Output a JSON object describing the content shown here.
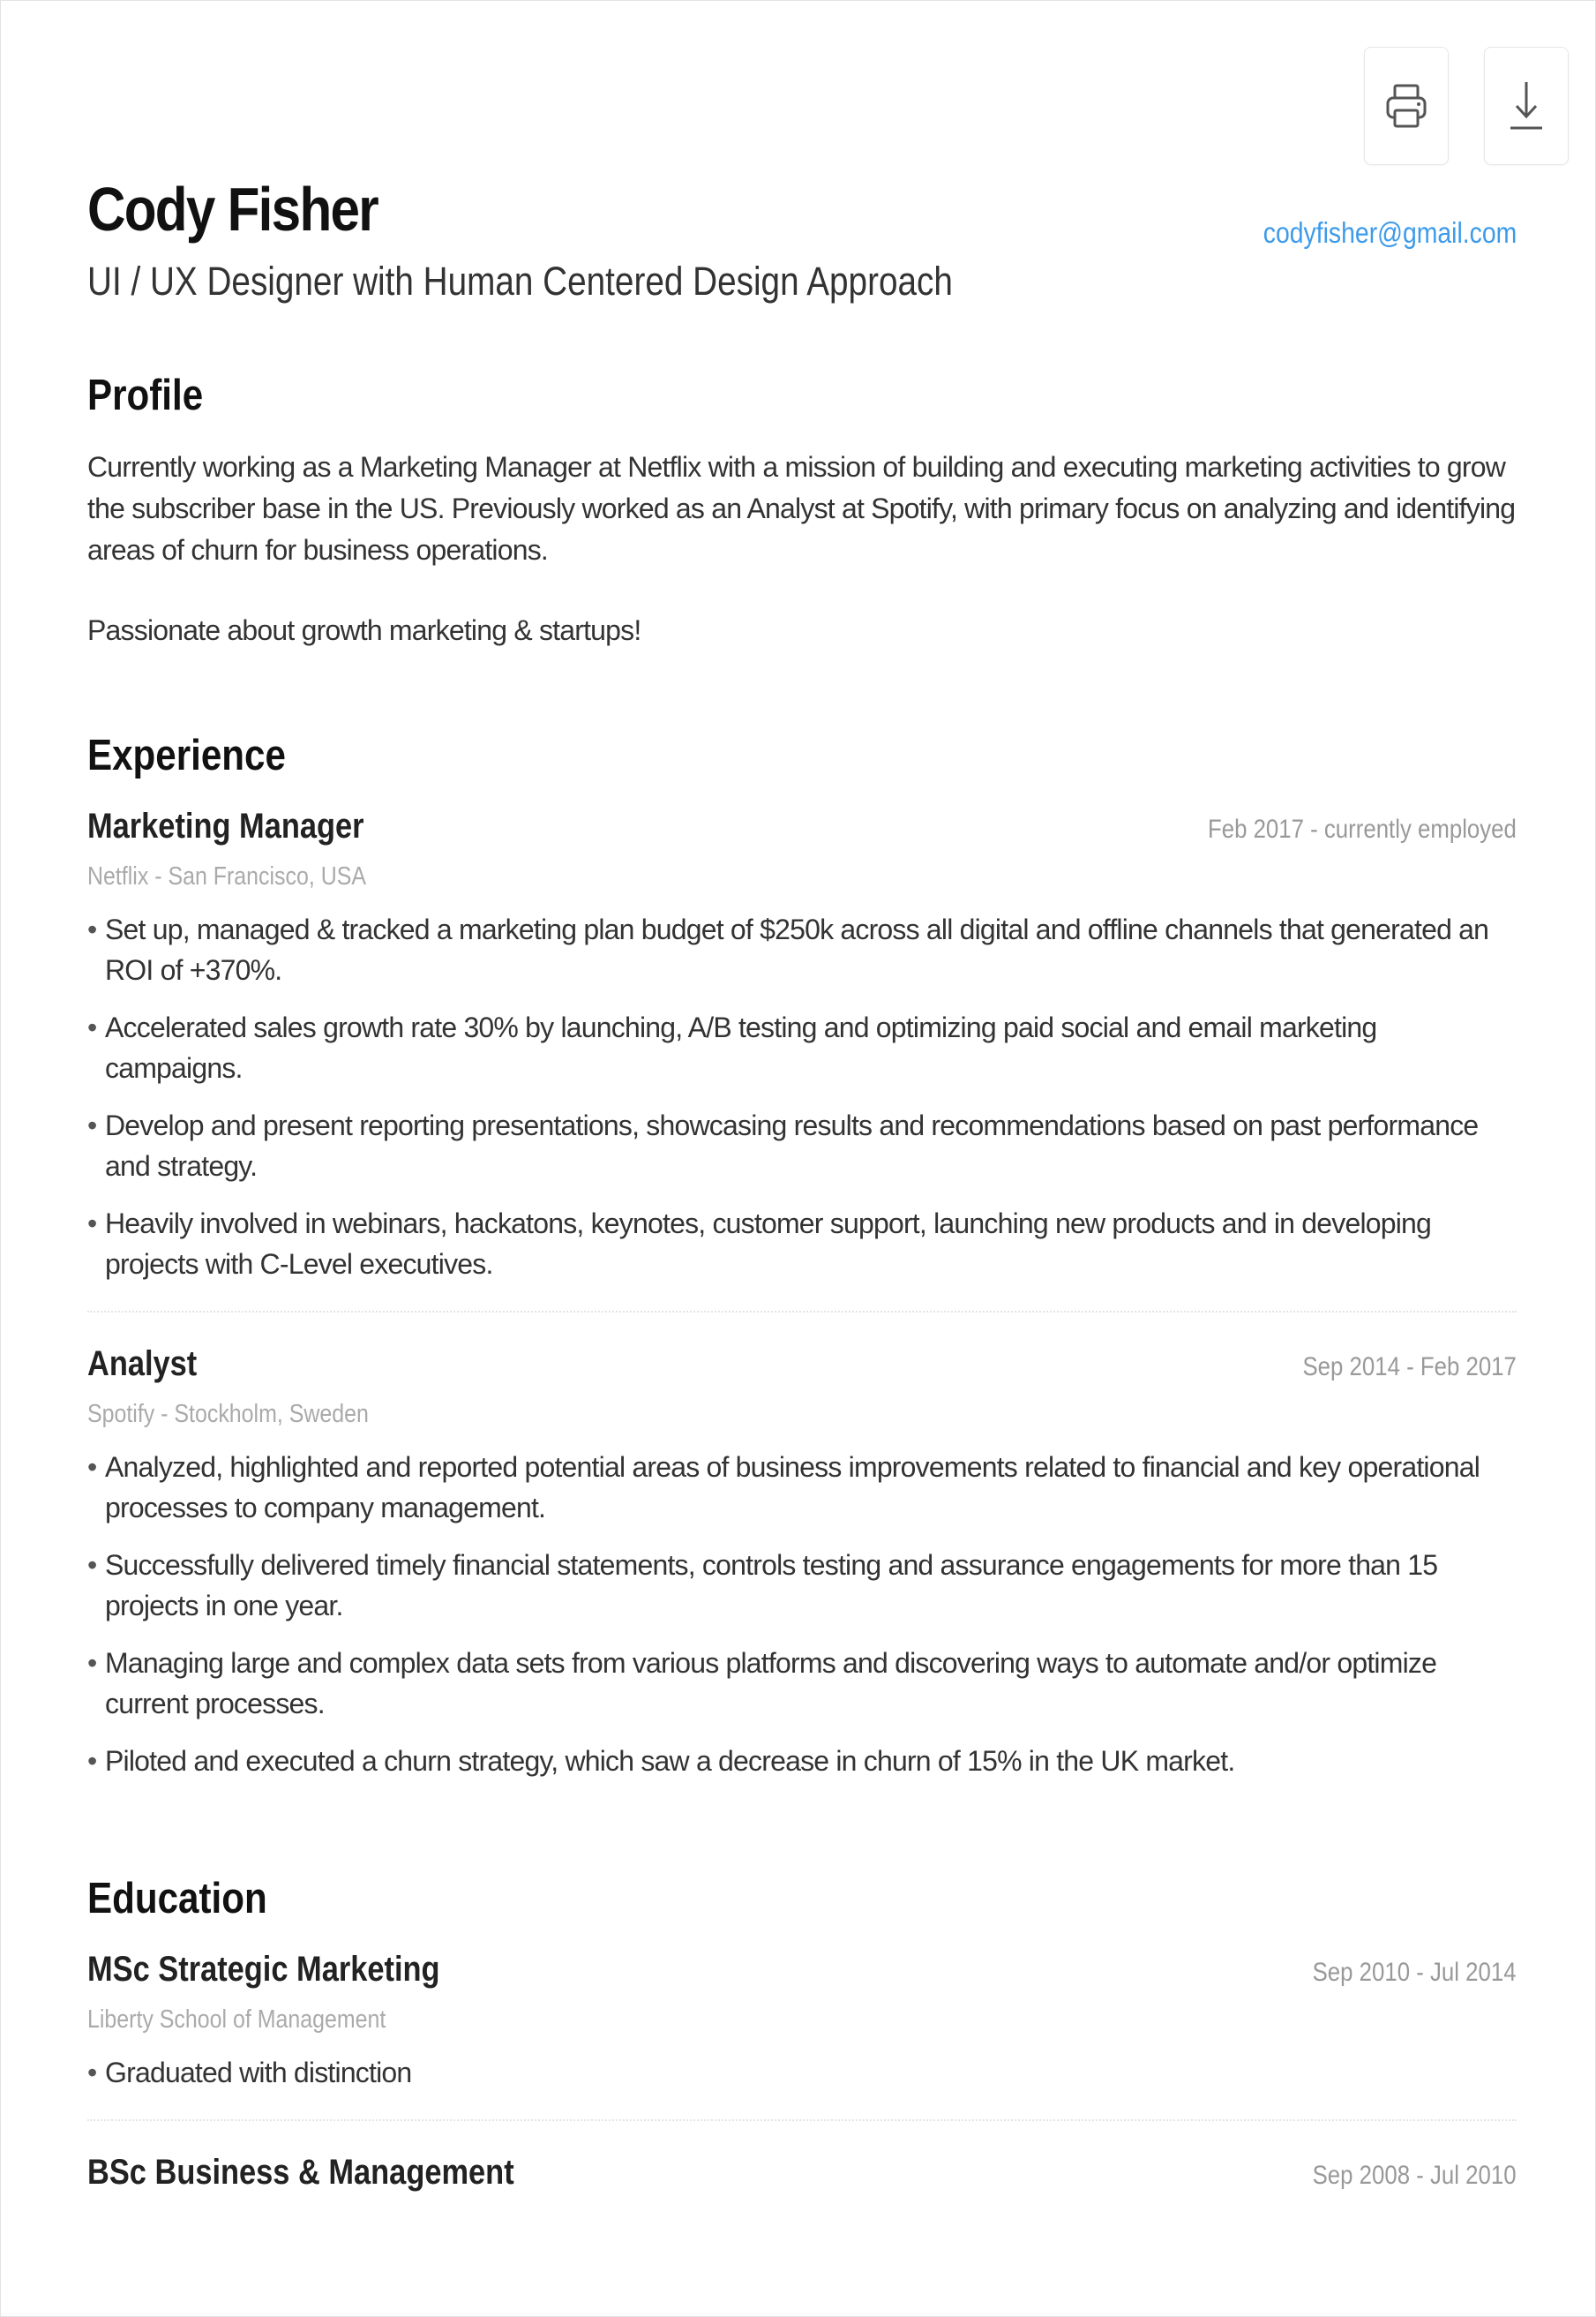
{
  "toolbar": {
    "print_icon": "printer-icon",
    "download_icon": "download-icon"
  },
  "header": {
    "name": "Cody Fisher",
    "tagline": "UI / UX Designer with Human Centered Design Approach",
    "email": "codyfisher@gmail.com"
  },
  "profile": {
    "title": "Profile",
    "paragraphs": [
      "Currently working as a Marketing Manager at Netflix with a mission of building and executing marketing activities to grow the subscriber base in the US. Previously worked as an Analyst at Spotify, with primary focus on analyzing and identifying areas of churn for business operations.",
      "Passionate about growth marketing & startups!"
    ]
  },
  "experience": {
    "title": "Experience",
    "jobs": [
      {
        "role": "Marketing Manager",
        "dates": "Feb 2017 - currently employed",
        "org": "Netflix - San Francisco, USA",
        "bullets": [
          "Set up, managed & tracked a marketing plan budget of $250k across all digital and offline channels that generated an ROI of +370%.",
          "Accelerated sales growth rate 30% by launching, A/B testing and optimizing paid social and email marketing campaigns.",
          "Develop and present reporting presentations, showcasing results and recommendations based on past performance and strategy.",
          "Heavily involved in webinars, hackatons, keynotes, customer support, launching new products and in developing projects with C-Level executives."
        ]
      },
      {
        "role": "Analyst",
        "dates": "Sep 2014 - Feb 2017",
        "org": "Spotify - Stockholm, Sweden",
        "bullets": [
          "Analyzed, highlighted and reported potential areas of business improvements related to financial and key operational processes to company management.",
          "Successfully delivered timely financial statements, controls testing and assurance engagements for more than 15 projects in one year.",
          "Managing large and complex data sets from various platforms and discovering ways to automate and/or optimize current processes.",
          "Piloted and executed a churn strategy, which saw a decrease in churn of 15% in the UK market."
        ]
      }
    ]
  },
  "education": {
    "title": "Education",
    "items": [
      {
        "degree": "MSc Strategic Marketing",
        "dates": "Sep 2010 - Jul 2014",
        "school": "Liberty School of Management",
        "bullets": [
          "Graduated with distinction"
        ]
      },
      {
        "degree": "BSc Business & Management",
        "dates": "Sep 2008 - Jul 2010"
      }
    ]
  }
}
